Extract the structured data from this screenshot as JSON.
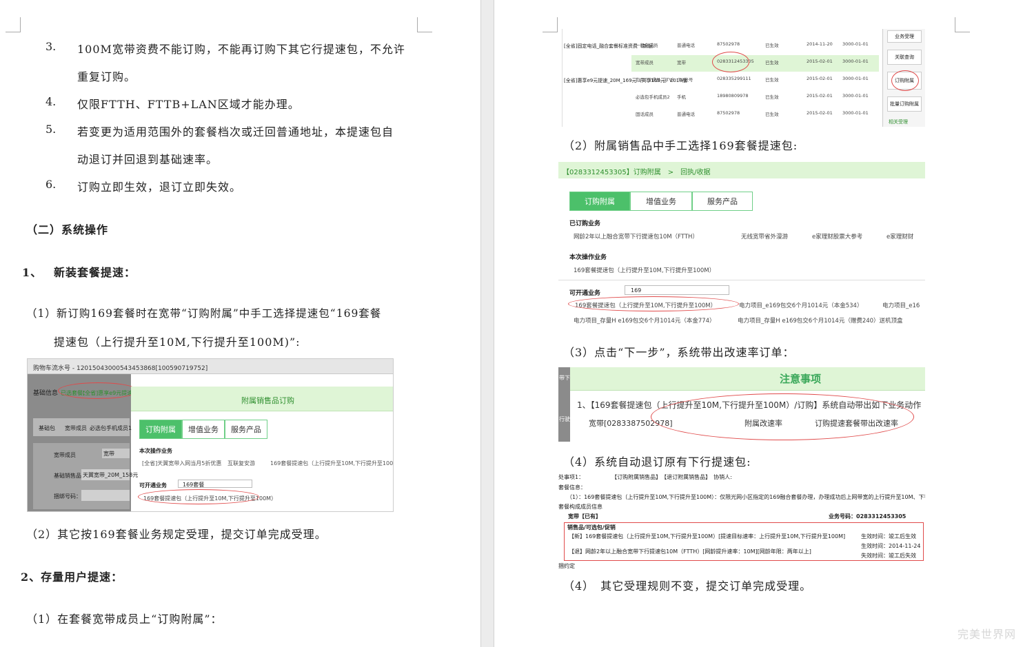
{
  "left_page": {
    "items": [
      {
        "num": "3.",
        "line1": "100M宽带资费不能订购，不能再订购下其它行提速包，不允许",
        "line2": "重复订购。"
      },
      {
        "num": "4.",
        "line1": "仅限FTTH、FTTB+LAN区域才能办理。",
        "line2": ""
      },
      {
        "num": "5.",
        "line1": "若变更为适用范围外的套餐档次或迁回普通地址，本提速包自",
        "line2": "动退订并回退到基础速率。"
      },
      {
        "num": "6.",
        "line1": "订购立即生效，退订立即失效。",
        "line2": ""
      }
    ],
    "section_heading": "（二）系统操作",
    "sub1_num": "1、",
    "sub1_title": "新装套餐提速：",
    "step1_line1": "（1）新订购169套餐时在宽带“订购附属”中手工选择提速包“169套餐",
    "step1_line2": "提速包（上行提升至10M,下行提升至100M)”:",
    "shot1": {
      "cart_line": "购物车流水号 - 1201504300054345386​8[100590719752]",
      "basic_info": "基础信息",
      "selected_pkg": "已选套餐：",
      "pkg_name": "[全省]惠享e9元提速_20",
      "left_tabs": [
        "基础包",
        "宽带成员",
        "必选包手机成员1"
      ],
      "rows": [
        {
          "label": "宽带成员",
          "value": "宽带"
        },
        {
          "label": "基础销售品：",
          "value": "天翼宽带_20M_158元"
        },
        {
          "label": "捆绑号码：",
          "value": ""
        }
      ],
      "panel_title": "附属销售品订购",
      "tabs": [
        "订购附属",
        "增值业务",
        "服务产品"
      ],
      "this_op": "本次操作业务",
      "op_items": [
        "[全省]天翼宽带入网当月5折优惠",
        "互联复安游",
        "169套餐提速包（上行提升至10M,下行提升至100M）"
      ],
      "available": "可开通业务",
      "search_value": "169套餐",
      "available_item": "169套餐提速包（上行提升至10M,下行提升至100M）"
    },
    "step2": "（2）其它按169套餐业务规定受理，提交订单完成受理。",
    "sub2": "2、存量用户提速：",
    "step_last": "（1）在套餐宽带成员上“订购附属”："
  },
  "right_page": {
    "shot_top": {
      "pkg1": "[全省]固定电话_融合套餐标准资费（新版）",
      "pkg2": "[全省]惠享e9元提速_20M_169元（共享169元）2018版",
      "rows": [
        [
          "一般化成员",
          "普通电话",
          "87502978",
          "已生效",
          "2014-11-20",
          "3000-01-01"
        ],
        [
          "宽带成员",
          "宽带",
          "0283312453305",
          "已生效",
          "2015-02-01",
          "3000-01-01"
        ],
        [
          "包月iTV成员（iTV）",
          "ITV帐号",
          "028335299111",
          "已生效",
          "2015-02-01",
          "3000-01-01"
        ],
        [
          "必选包手机成员2",
          "手机",
          "18980809978",
          "已生效",
          "2015-02-01",
          "3000-01-01"
        ],
        [
          "固话成员",
          "普通电话",
          "87502978",
          "已生效",
          "2015-02-01",
          "3000-01-01"
        ]
      ],
      "side_buttons": [
        "业务受理",
        "关联查询",
        "订购附属",
        "批量订购附属",
        "相关受理"
      ]
    },
    "cap2": "（2）附属销售品中手工选择169套餐提速包:",
    "shot2": {
      "breadcrumb": "【0283312453305】订购附属　>　回执/收据",
      "tabs": [
        "订购附属",
        "增值业务",
        "服务产品"
      ],
      "ordered": "已订购业务",
      "ordered_items": [
        "网龄2年以上融合宽带下行提速包10M（FTTH）",
        "无线宽带省外漫游",
        "e家理财股票大参考",
        "e家理财财"
      ],
      "this_op": "本次操作业务",
      "this_op_item": "169套餐提速包（上行提升至10M,下行提升至100M）",
      "available": "可开通业务",
      "search_value": "169",
      "avail_row1": [
        "169套餐提速包（上行提升至10M,下行提升至100M）",
        "电力项目_e169包交6个月1014元（本金534）",
        "电力项目_e16"
      ],
      "avail_row2": [
        "电力项目_存量H e169包交6个月1014元（本金774）",
        "电力项目_存量H e169包交6个月1014元（赠费240）送机顶盒"
      ]
    },
    "cap3": "（3）点击“下一步”，系统带出改速率订单：",
    "shot3": {
      "title": "注意事项",
      "line1": "1、【169套餐提速包（上行提升至10M,下行提升至100M）/订购】系统自动带出如下业务动作",
      "col1": "宽带[0283387502978]",
      "col2": "附属改速率",
      "col3": "订购提速套餐带出改速率",
      "side1": "带下",
      "side2": "行驶"
    },
    "cap4": "（4）系统自动退订原有下行提速包:",
    "shot4": {
      "header": "处事项1：　　　　　　【订购附属销售品】　【退订附属销售品】　协销人:",
      "sub_header": "套餐信息：",
      "notice": "（1）：169套餐提速包（上行提升至10M,下行提升至100M）：仅限光网小区指定的169融合套餐办理，办理成功后上网带宽的上行提升至10M、下行",
      "members": "套餐构成成员信息",
      "broadband": "宽带【已有】",
      "biz_no": "业务号码：0283312453305",
      "sales": "销售品/可选包/促销",
      "new_item": "【新】169套餐提速包（上行提升至10M,下行提升至100M）[提速目标速率：上行提升至10M,下行提升至100M]",
      "new_eff": "生效时间：竣工后生效",
      "old_item": "【退】网龄2年以上融合宽带下行提速包10M（FTTH）[网龄提升速率：10M][网龄年限：两年以上]",
      "old_eff1": "生效时间：2014-11-24",
      "old_eff2": "失效时间：竣工后失效",
      "footer": "捆约定"
    },
    "cap5": "（4）　其它受理规则不变，提交订单完成受理。"
  },
  "watermark": "完美世界网",
  "colors": {
    "accent_green": "#4cc06a",
    "light_green": "#dff5d6",
    "ellipse_red": "#e04a4a"
  }
}
